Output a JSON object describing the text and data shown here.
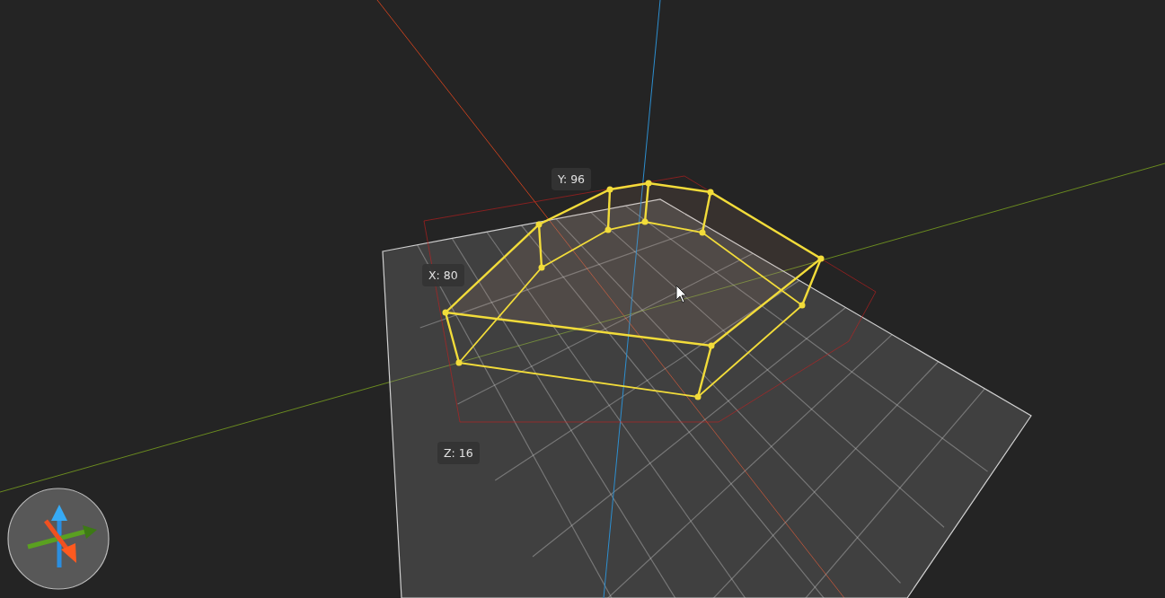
{
  "viewport": {
    "dimension_labels": [
      {
        "text": "Y: 96"
      },
      {
        "text": "X: 80"
      },
      {
        "text": "Z: 16"
      }
    ]
  }
}
